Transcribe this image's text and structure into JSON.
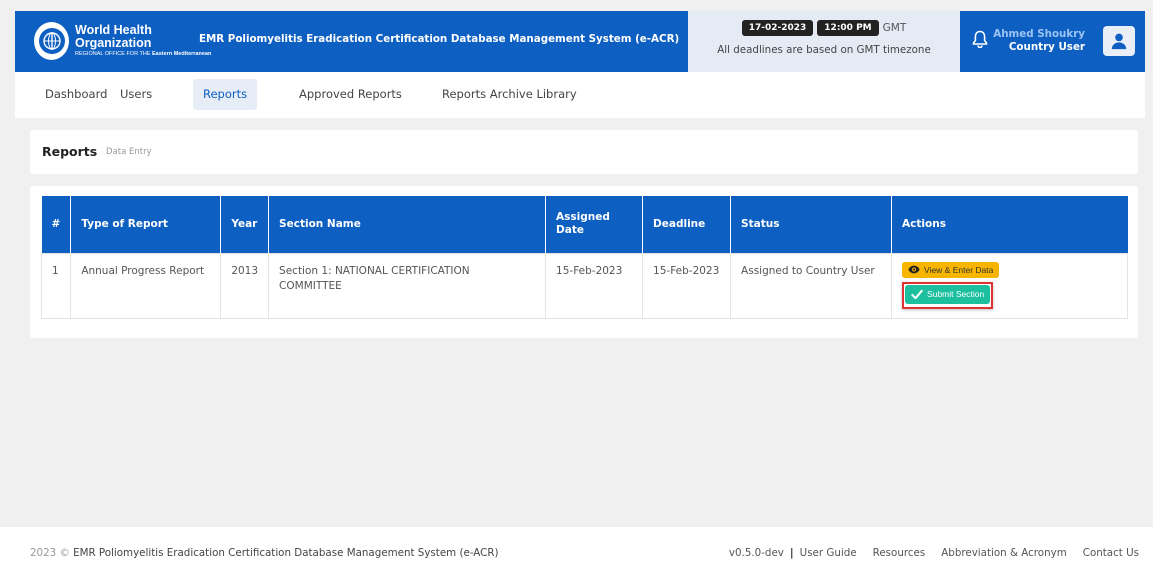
{
  "header": {
    "logo_line1": "World Health",
    "logo_line2": "Organization",
    "logo_line3_prefix": "REGIONAL OFFICE FOR THE",
    "logo_line3_bold": "Eastern Mediterranean",
    "system_title": "EMR Poliomyelitis Eradication Certification Database Management System (e-ACR)",
    "date": "17-02-2023",
    "time": "12:00 PM",
    "timezone": "GMT",
    "deadline_note": "All deadlines are based on GMT timezone",
    "user_name": "Ahmed Shoukry",
    "user_role": "Country User"
  },
  "nav": {
    "items": [
      {
        "label": "Dashboard"
      },
      {
        "label": "Users"
      },
      {
        "label": "Reports"
      },
      {
        "label": "Approved Reports"
      },
      {
        "label": "Reports Archive Library"
      }
    ],
    "active": "Reports"
  },
  "breadcrumb": {
    "title": "Reports",
    "subtitle": "Data Entry"
  },
  "table": {
    "headers": [
      "#",
      "Type of Report",
      "Year",
      "Section Name",
      "Assigned Date",
      "Deadline",
      "Status",
      "Actions"
    ],
    "rows": [
      {
        "num": "1",
        "type": "Annual Progress Report",
        "year": "2013",
        "section": "Section 1: NATIONAL CERTIFICATION COMMITTEE",
        "assigned": "15-Feb-2023",
        "deadline": "15-Feb-2023",
        "status": "Assigned to Country User",
        "view_label": "View & Enter Data",
        "submit_label": "Submit Section"
      }
    ]
  },
  "footer": {
    "year": "2023 ©",
    "system": "EMR Poliomyelitis Eradication Certification Database Management System (e-ACR)",
    "version": "v0.5.0-dev",
    "separator": "|",
    "links": [
      "User Guide",
      "Resources",
      "Abbreviation & Acronym",
      "Contact Us"
    ]
  },
  "colors": {
    "primary": "#0d5fc2",
    "warning": "#f7b500",
    "success": "#1cbf9e",
    "highlight": "#dd3333"
  }
}
